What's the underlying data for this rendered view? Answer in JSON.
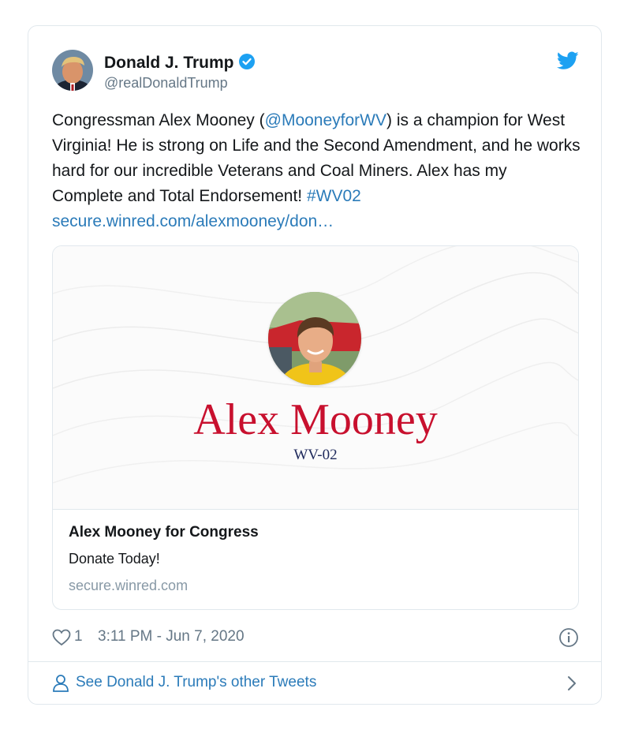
{
  "author": {
    "name": "Donald J. Trump",
    "handle": "@realDonaldTrump"
  },
  "tweet": {
    "text_1": "Congressman Alex Mooney (",
    "mention": "@MooneyforWV",
    "text_2": ") is a champion for West Virginia! He is strong on Life and the Second Amendment, and he works hard for our incredible Veterans and Coal Miners. Alex has my Complete and Total Endorsement! ",
    "hashtag": "#WV02",
    "link": "secure.winred.com/alexmooney/don…"
  },
  "card": {
    "candidate_name": "Alex Mooney",
    "district": "WV-02",
    "title": "Alex Mooney for Congress",
    "description": "Donate Today!",
    "domain": "secure.winred.com"
  },
  "footer": {
    "like_count": "1",
    "timestamp": "3:11 PM - Jun 7, 2020",
    "other_tweets": "See Donald J. Trump's other Tweets"
  },
  "colors": {
    "link": "#2b7bb9",
    "twitter_blue": "#1da1f2",
    "candidate_red": "#c8102e"
  }
}
